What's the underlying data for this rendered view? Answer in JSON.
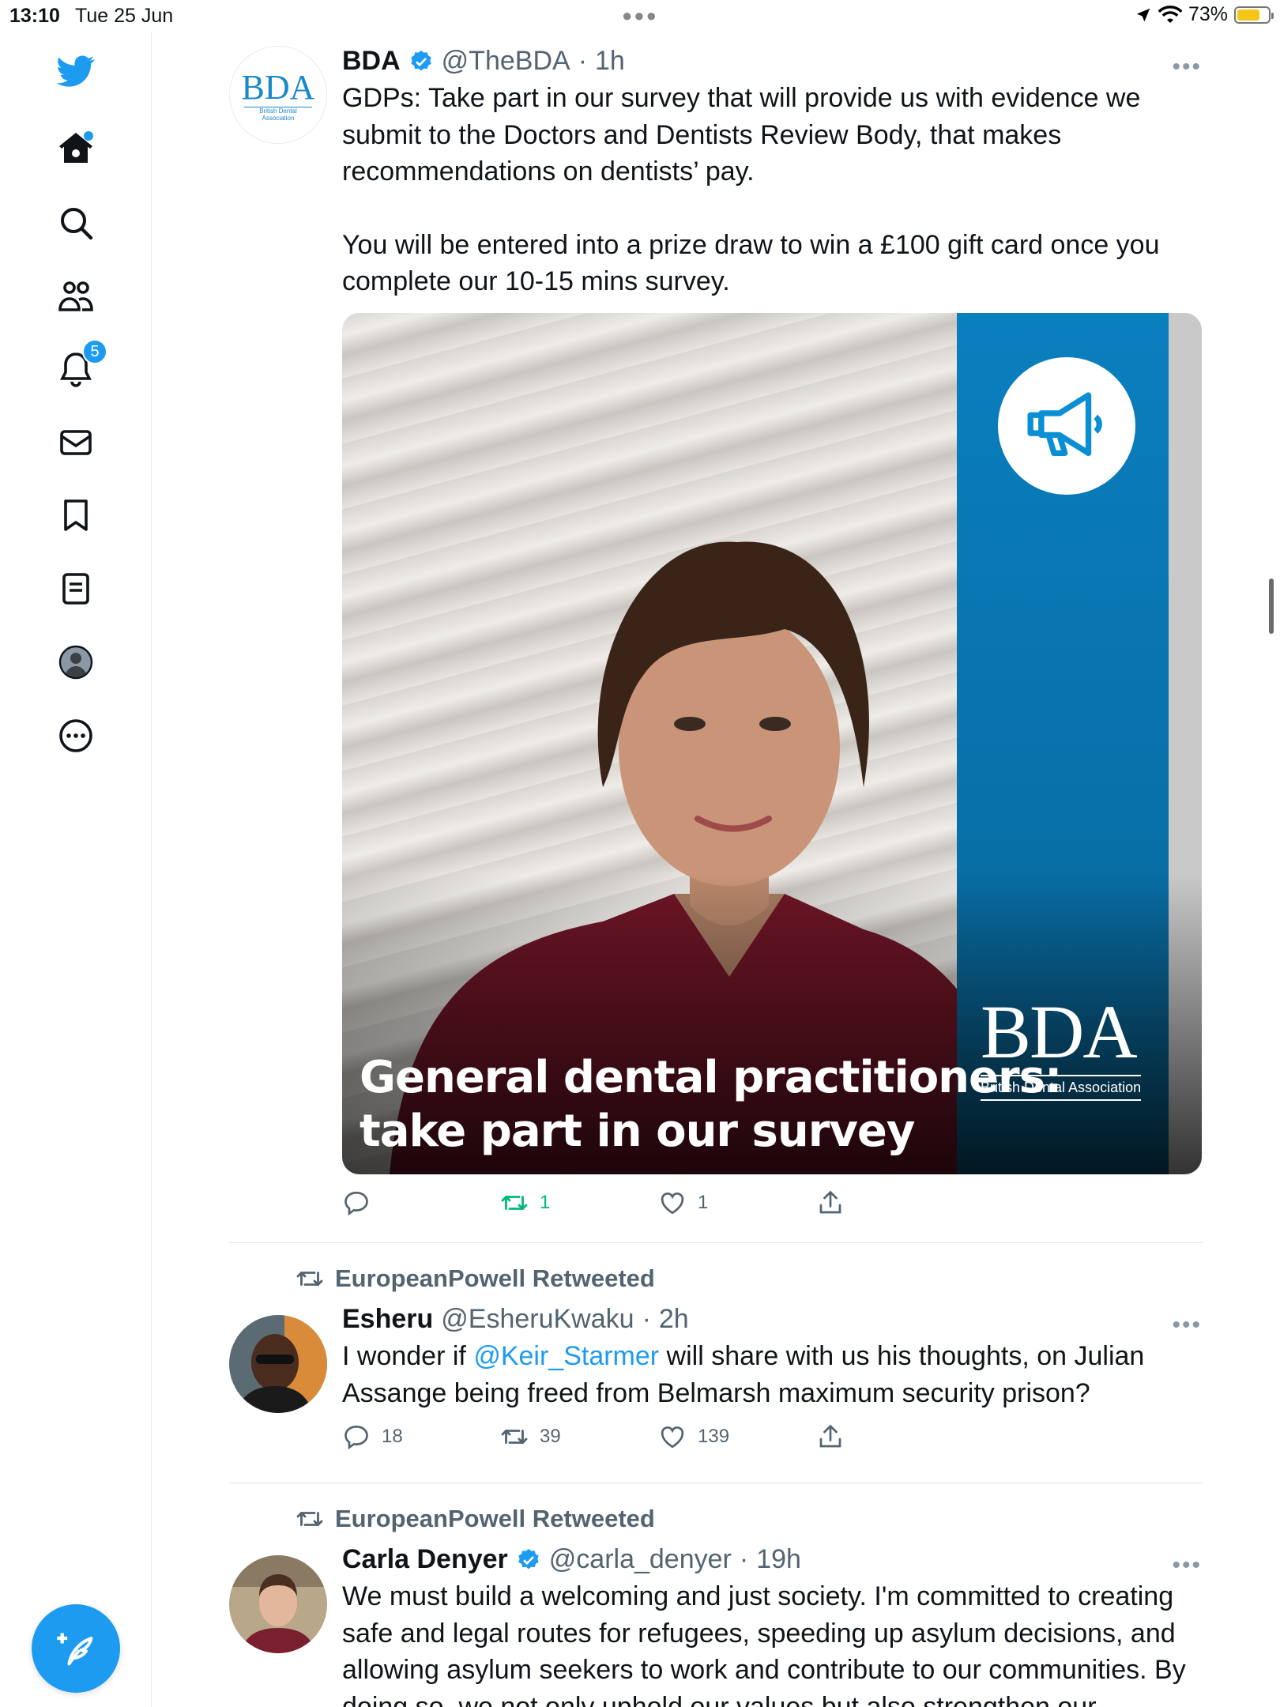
{
  "status_bar": {
    "time": "13:10",
    "date": "Tue 25 Jun",
    "battery": "73%",
    "battery_level": 0.73
  },
  "sidebar": {
    "notifications_badge": "5",
    "accent": "#1d9bf0"
  },
  "tweets": [
    {
      "name": "BDA",
      "handle": "@TheBDA",
      "time": "1h",
      "avatar_logo": "BDA",
      "avatar_logo_sub": "British Dental Association",
      "text_p1": "GDPs: Take part in our survey that will provide us with evidence we submit to the Doctors and Dentists Review Body, that makes recommendations on dentists’ pay.",
      "text_p2": "You will be entered into a prize draw to win a £100 gift card once you complete our 10-15 mins survey.",
      "media": {
        "title_line1": "General dental practitioners:",
        "title_line2": "take part in our survey",
        "logo": "BDA",
        "logo_sub": "British Dental Association"
      },
      "replies": "",
      "retweets": "1",
      "likes": "1"
    },
    {
      "retweeted_by": "EuropeanPowell Retweeted",
      "name": "Esheru",
      "handle": "@EsheruKwaku",
      "time": "2h",
      "text_before": "I wonder if ",
      "mention": "@Keir_Starmer",
      "text_after": " will share with us his thoughts, on Julian Assange being freed from Belmarsh maximum security prison?",
      "replies": "18",
      "retweets": "39",
      "likes": "139"
    },
    {
      "retweeted_by": "EuropeanPowell Retweeted",
      "name": "Carla Denyer",
      "handle": "@carla_denyer",
      "time": "19h",
      "text": "We must build a welcoming and just society. I'm committed to creating safe and legal routes for refugees, speeding up asylum decisions, and allowing asylum seekers to work and contribute to our communities. By doing so, we not only uphold our values but also strengthen our"
    }
  ]
}
